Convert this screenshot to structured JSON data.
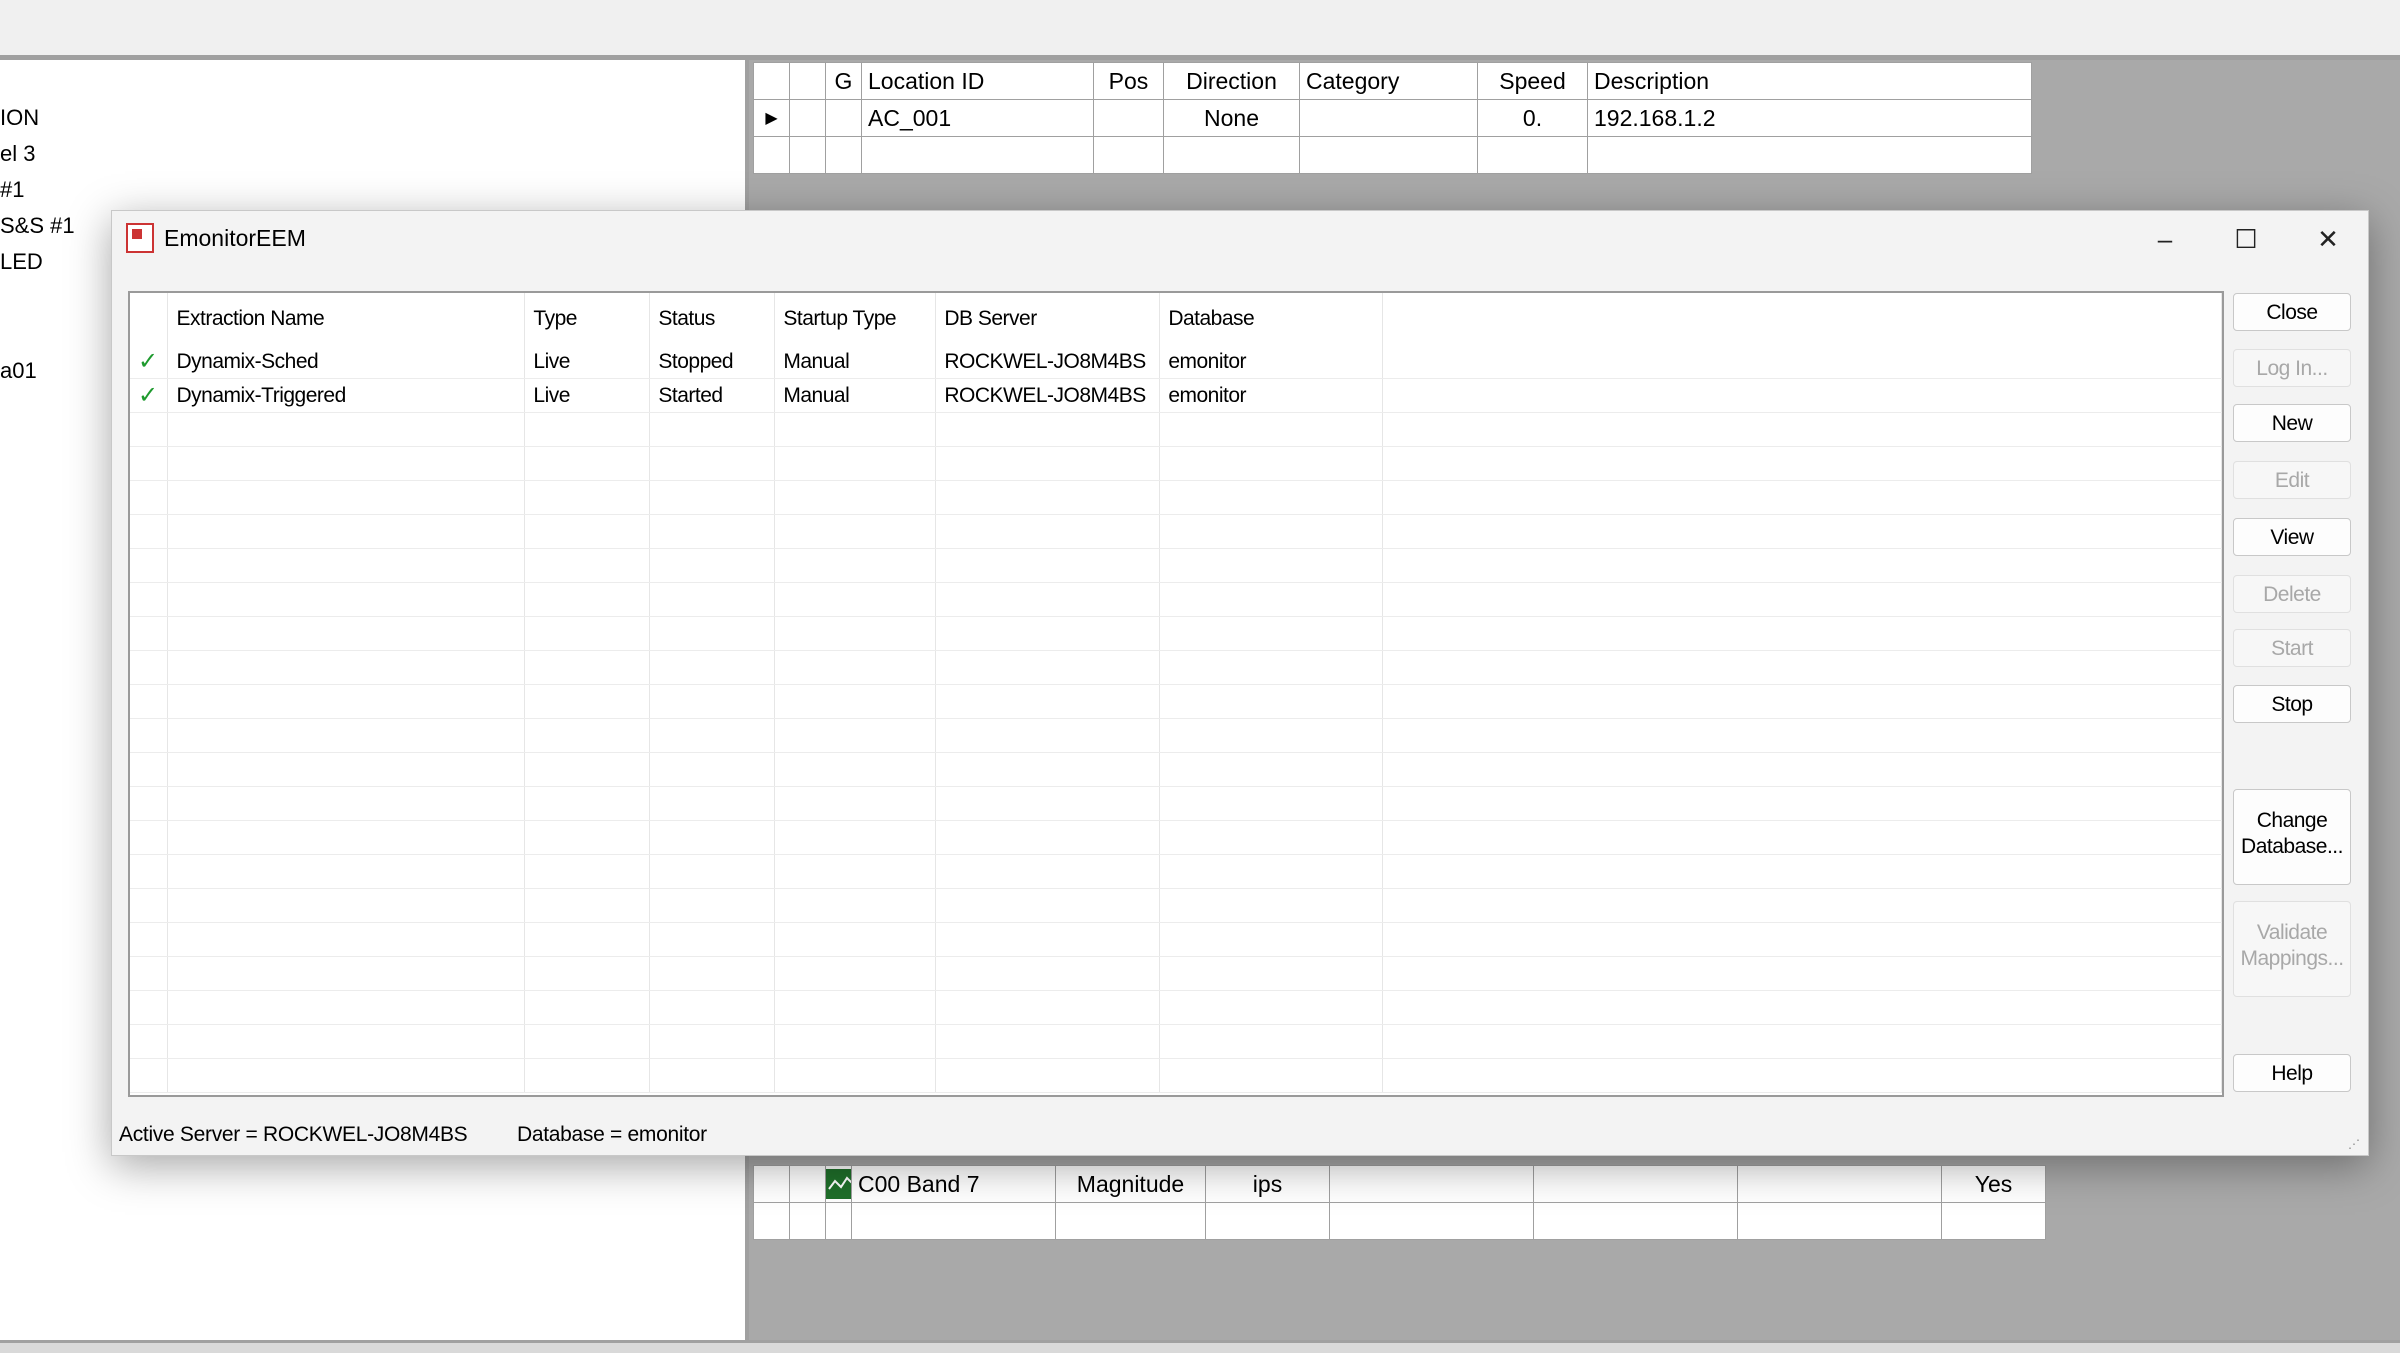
{
  "tree": {
    "items": [
      "ION",
      "el 3",
      "#1",
      "S&S #1",
      "LED",
      "a01"
    ]
  },
  "top_grid": {
    "headers": [
      "",
      "",
      "G",
      "Location ID",
      "Pos",
      "Direction",
      "Category",
      "Speed",
      "Description"
    ],
    "row": {
      "location_id": "AC_001",
      "pos": "",
      "direction": "None",
      "category": "",
      "speed": "0.",
      "description": "192.168.1.2"
    }
  },
  "bottom_grid": {
    "row": {
      "name": "C00 Band 7",
      "type": "Magnitude",
      "units": "ips",
      "c4": "",
      "c5": "",
      "c6": "",
      "flag": "Yes"
    }
  },
  "dialog": {
    "title": "EmonitorEEM",
    "window_controls": {
      "minimize": "–",
      "maximize": "☐",
      "close": "✕"
    },
    "columns": [
      "Extraction Name",
      "Type",
      "Status",
      "Startup Type",
      "DB Server",
      "Database"
    ],
    "rows": [
      {
        "name": "Dynamix-Sched",
        "type": "Live",
        "status": "Stopped",
        "startup": "Manual",
        "server": "ROCKWEL-JO8M4BS",
        "database": "emonitor"
      },
      {
        "name": "Dynamix-Triggered",
        "type": "Live",
        "status": "Started",
        "startup": "Manual",
        "server": "ROCKWEL-JO8M4BS",
        "database": "emonitor"
      }
    ],
    "buttons": {
      "close": "Close",
      "login": "Log In...",
      "new": "New",
      "edit": "Edit",
      "view": "View",
      "delete": "Delete",
      "start": "Start",
      "stop": "Stop",
      "change_db_1": "Change",
      "change_db_2": "Database...",
      "validate_1": "Validate",
      "validate_2": "Mappings...",
      "help": "Help"
    },
    "status": {
      "server": "Active Server = ROCKWEL-JO8M4BS",
      "database": "Database = emonitor"
    }
  },
  "colors": {
    "check": "#1e9a2e",
    "background_pane": "#a9a9a9",
    "disabled_text": "#a8a8a8"
  }
}
